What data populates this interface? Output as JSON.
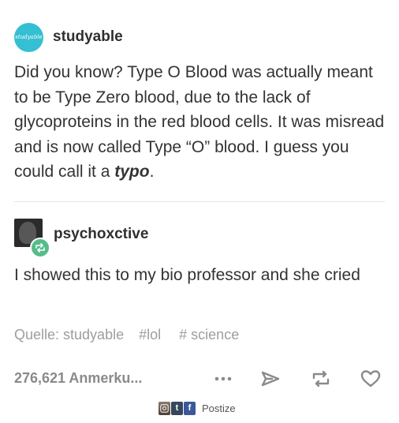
{
  "original_post": {
    "avatar_text": "studyable",
    "username": "studyable",
    "text_main": "Did you know? Type O Blood was actually meant to be Type Zero blood, due to the lack of glycoproteins in the red blood cells. It was misread and is now called Type “O” blood. I guess you could call it a ",
    "text_emphasis": "typo",
    "text_end": "."
  },
  "reply": {
    "username": "psychoxctive",
    "text": "I showed this to my bio professor and she cried"
  },
  "tags": {
    "source": "Quelle: studyable",
    "items": [
      "#lol",
      "# science"
    ]
  },
  "footer": {
    "notes": "276,621 Anmerku...",
    "icons": [
      "more-icon",
      "share-icon",
      "reblog-icon",
      "like-icon"
    ]
  },
  "watermark": {
    "label": "Postize",
    "tumblr_letter": "t",
    "facebook_letter": "f"
  },
  "colors": {
    "avatar": "#34bfd2",
    "reblog_badge": "#56bc8a",
    "icon": "#8a8a8a"
  }
}
